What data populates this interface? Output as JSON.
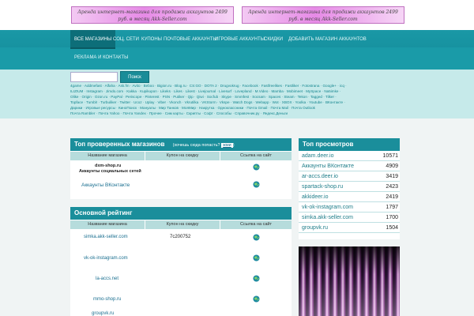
{
  "banners": {
    "left": "Аренда интернет-магазина для продажи аккаунтов 2499 руб. в месяц Akk-Seller.com",
    "right": "Аренда интернет-магазина для продажи аккаунтов 2499 руб. в месяц Akk-Seller.com"
  },
  "nav": {
    "items": [
      "Все магазины",
      "Соц. сети",
      "Купоны",
      "Почтовые аккаунты",
      "Игровые аккаунты",
      "Скидки",
      "Добавить магазин аккаунтов"
    ],
    "row2": [
      "Реклама и контакты"
    ]
  },
  "search": {
    "placeholder": "",
    "button": "Поиск"
  },
  "tags": {
    "line1": "4game · Addmefast · Alfaha · Ask.fm · Avito · Beboo · Bigion.ru · Blog.ru · CS:GO · DOTA 2 · Drugvokrug · Facebook · Fastfreelikes · Fastliker · Fotostrana · Google+ · icq ·",
    "line2": "ILIZIUM · Instagram · Jimdo.com · Kakka · Kupikupon · Likeks · Likes · Likest · Livejournal · Livesurf · Lovepland · M.Video · Mamba · Mobimeet · MySpace · Na5imke ·",
    "line3": "Olike · Origin · Ozon.ru · PayPal · Periscope · Pinterest · PSN · Putiker · Qip · Qiwi · Socfub · Skype · Smmfest · Socsam · Spaces · Steam · Tekon · Tagged · Tilker ·",
    "line4": "Topface · Tumblr · Turbuliker · Twitter · Ucoz · Uplay · Viber · Vkonch · Vkrutilka · VKStorm · Vkspe · Watch Dogs · Webapp · Wot · XBOX · Yoolka · Youtube · ВКонтакте ·",
    "line5": "Дарики · Игровые ресурсы · КиноПоиск · Мануалы · Мир Танков · МояМир · Накрутка · Одноклассники · Почта Gmail · Почта Mail · Почта Outlook",
    "line6": "Почта Rambler · Почта Yahoo · Почта Yandex · Прочее · Сим карты · Скрипты · Софт · Способы · Справочник.ру · Яндекс.Деньги"
  },
  "top_shops": {
    "title": "Топ проверенных магазинов",
    "note": "(хочешь сюда попасть?",
    "note_link": "жми",
    "note_end": ")",
    "columns": [
      "Название магазина",
      "Купон на скидку",
      "Ссылка на сайт"
    ],
    "row1_name": "dxm-shop.ru",
    "row1_desc": "Аккаунты социальных сетей",
    "row2_name": "Аккаунты ВКонтакте"
  },
  "main_rating": {
    "title": "Основной рейтинг",
    "columns": [
      "Название магазина",
      "Купон на скидку",
      "Ссылка на сайт"
    ],
    "rows": [
      {
        "name": "simka.akk-seller.com",
        "coupon": "7c200752"
      },
      {
        "name": "vk-ok-instagram.com",
        "coupon": ""
      },
      {
        "name": "la-accs.net",
        "coupon": ""
      },
      {
        "name": "mmo-shop.ru",
        "coupon": ""
      },
      {
        "name": "groupvk.ru",
        "coupon": ""
      }
    ]
  },
  "top_views": {
    "title": "Топ просмотров",
    "rows": [
      {
        "name": "adam.deer.io",
        "count": "10571"
      },
      {
        "name": "Аккаунты ВКонтакте",
        "count": "4909"
      },
      {
        "name": "ar-accs.deer.io",
        "count": "3419"
      },
      {
        "name": "spartack-shop.ru",
        "count": "2423"
      },
      {
        "name": "akkideer.io",
        "count": "2419"
      },
      {
        "name": "vk-ok-instagram.com",
        "count": "1797"
      },
      {
        "name": "simka.akk-seller.com",
        "count": "1700"
      },
      {
        "name": "groupvk.ru",
        "count": "1504"
      }
    ]
  },
  "colors": {
    "header": "#1a98a6",
    "accent": "#1a8e9b",
    "link": "#1a6f90",
    "tag_bg": "#c6eaea"
  }
}
